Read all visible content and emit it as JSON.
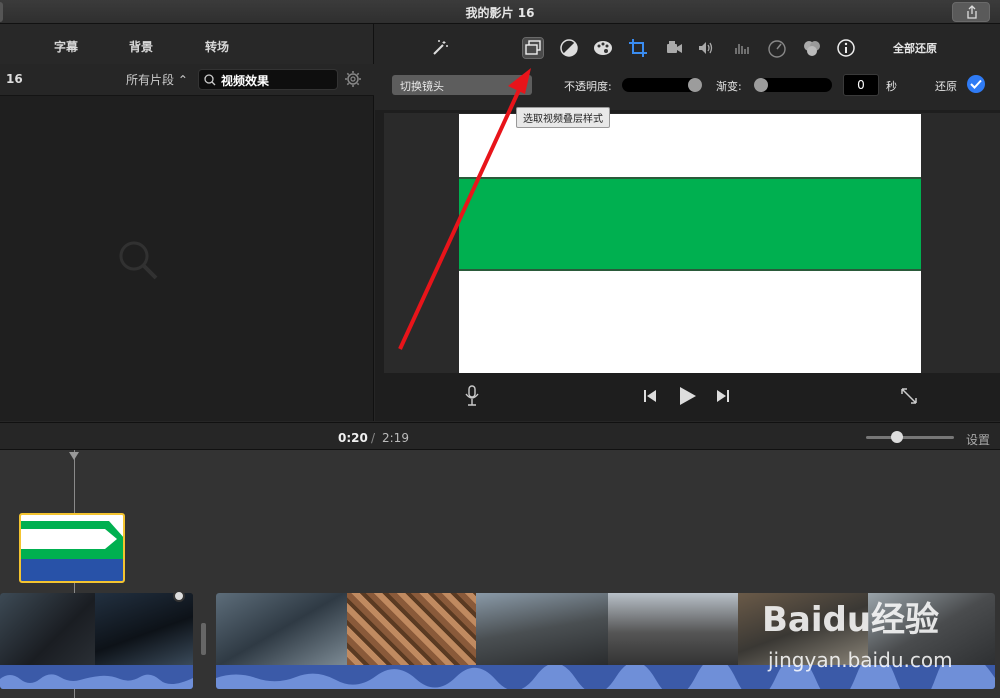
{
  "window": {
    "title": "我的影片 16"
  },
  "browser": {
    "tabs": [
      "字幕",
      "背景",
      "转场"
    ],
    "project_number": "16",
    "filter_label": "所有片段",
    "search_value": "视频效果"
  },
  "viewer": {
    "toolbar": {
      "reset_all": "全部还原"
    },
    "controls": {
      "clip_select": "切换镜头",
      "opacity_label": "不透明度:",
      "fade_label": "渐变:",
      "fade_value": "0",
      "seconds_label": "秒",
      "restore_label": "还原"
    },
    "tooltip": "选取视频叠层样式",
    "opacity_level": 1.0,
    "fade_level": 0.0
  },
  "timebar": {
    "current": "0:20",
    "separator": "/",
    "total": "2:19",
    "settings": "设置"
  },
  "watermark": {
    "logo": "Baidu经验",
    "url": "jingyan.baidu.com"
  },
  "colors": {
    "green_band": "#00b050",
    "selection": "#f4c430",
    "audio": "#3b5aa8",
    "accent": "#2f7bf5",
    "arrow": "#e8141a"
  }
}
